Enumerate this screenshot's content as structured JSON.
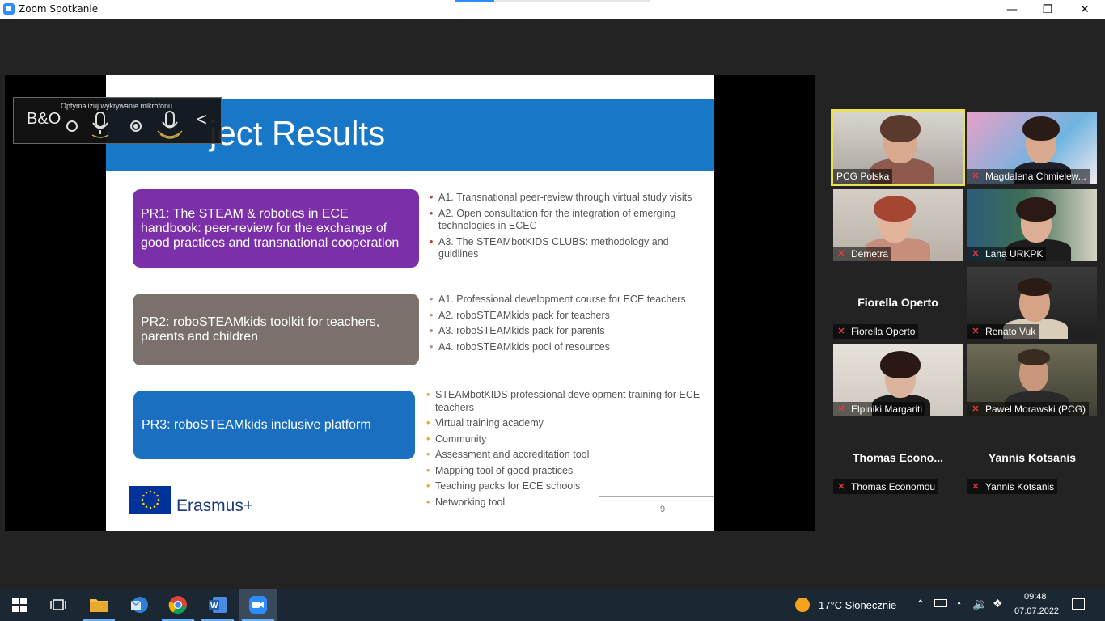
{
  "window": {
    "title": "Zoom Spotkanie",
    "minimize": "—",
    "restore": "❐",
    "close": "✕"
  },
  "mic_overlay": {
    "label": "Optymalizuj wykrywanie mikrofonu",
    "logo": "B&O",
    "back": "<"
  },
  "slide": {
    "title": "ject Results",
    "page_number": "9",
    "logo_text": "Erasmus+",
    "results": [
      {
        "label": "PR1: The STEAM & robotics in ECE handbook: peer-review for the exchange of good practices and transnational cooperation",
        "color": "#7b2fa8",
        "bullets": [
          "A1. Transnational peer-review through virtual study visits",
          "A2. Open consultation for the integration of emerging technologies in ECEC",
          "A3. The STEAMbotKIDS CLUBS: methodology and guidlines"
        ]
      },
      {
        "label": "PR2: roboSTEAMkids toolkit for teachers, parents and children",
        "color": "#7a716d",
        "bullets": [
          "A1. Professional development course for ECE teachers",
          "A2. roboSTEAMkids pack for teachers",
          "A3. roboSTEAMkids pack for parents",
          "A4. roboSTEAMkids pool of resources"
        ]
      },
      {
        "label": "PR3: roboSTEAMkids inclusive platform",
        "color": "#1a6fc0",
        "bullets": [
          "STEAMbotKIDS professional development training for ECE teachers",
          "Virtual training academy",
          "Community",
          "Assessment and accreditation tool",
          "Mapping tool of good practices",
          "Teaching packs for ECE schools",
          "Networking tool"
        ]
      }
    ]
  },
  "participants": [
    {
      "name": "PCG Polska",
      "muted": false,
      "video": true,
      "speaking": true
    },
    {
      "name": "Magdalena Chmielew...",
      "muted": true,
      "video": true,
      "speaking": false
    },
    {
      "name": "Demetra",
      "muted": true,
      "video": true,
      "speaking": false
    },
    {
      "name": "Lana URKPK",
      "muted": true,
      "video": true,
      "speaking": false
    },
    {
      "name": "Fiorella Operto",
      "display_name": "Fiorella Operto",
      "muted": true,
      "video": false,
      "speaking": false
    },
    {
      "name": "Renato Vuk",
      "muted": true,
      "video": true,
      "speaking": false
    },
    {
      "name": "Elpiniki Margariti",
      "muted": true,
      "video": true,
      "speaking": false
    },
    {
      "name": "Pawel Morawski (PCG)",
      "muted": true,
      "video": true,
      "speaking": false
    },
    {
      "name": "Thomas Economou",
      "display_name": "Thomas  Econo...",
      "muted": true,
      "video": false,
      "speaking": false
    },
    {
      "name": "Yannis Kotsanis",
      "display_name": "Yannis Kotsanis",
      "muted": true,
      "video": false,
      "speaking": false
    }
  ],
  "taskbar": {
    "apps": [
      "start-icon",
      "task-view-icon",
      "file-explorer-icon",
      "mail-icon",
      "chrome-icon",
      "word-icon",
      "zoom-icon"
    ],
    "weather": "17°C  Słonecznie",
    "time": "09:48",
    "date": "07.07.2022"
  },
  "colors": {
    "accent_blue": "#1977c8",
    "speaker_highlight": "#e8e05a",
    "mute_red": "#e0393e"
  }
}
